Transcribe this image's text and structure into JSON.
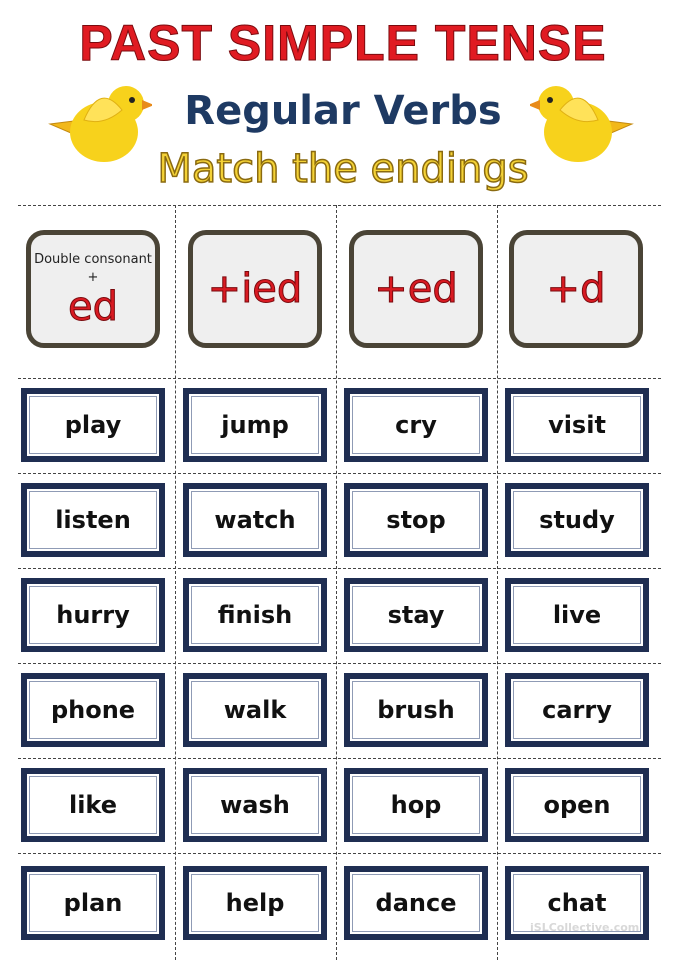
{
  "header": {
    "title": "PAST SIMPLE TENSE",
    "subtitle": "Regular Verbs",
    "instruction": "Match the endings"
  },
  "endings": [
    {
      "top_text": "Double consonant +",
      "ending": "ed"
    },
    {
      "top_text": "",
      "ending": "+ied"
    },
    {
      "top_text": "",
      "ending": "+ed"
    },
    {
      "top_text": "",
      "ending": "+d"
    }
  ],
  "verb_rows": [
    [
      "play",
      "jump",
      "cry",
      "visit"
    ],
    [
      "listen",
      "watch",
      "stop",
      "study"
    ],
    [
      "hurry",
      "finish",
      "stay",
      "live"
    ],
    [
      "phone",
      "walk",
      "brush",
      "carry"
    ],
    [
      "like",
      "wash",
      "hop",
      "open"
    ],
    [
      "plan",
      "help",
      "dance",
      "chat"
    ]
  ],
  "watermark": "iSLCollective.com",
  "colors": {
    "title": "#e01b22",
    "subtitle": "#1e3a63",
    "instruction": "#f4d236",
    "card_border": "#1f2e52",
    "ending_border": "#4a4436",
    "ending_text": "#d91a22",
    "bird": "#f7d21c"
  },
  "icons": [
    "bird-icon-left",
    "bird-icon-right"
  ]
}
